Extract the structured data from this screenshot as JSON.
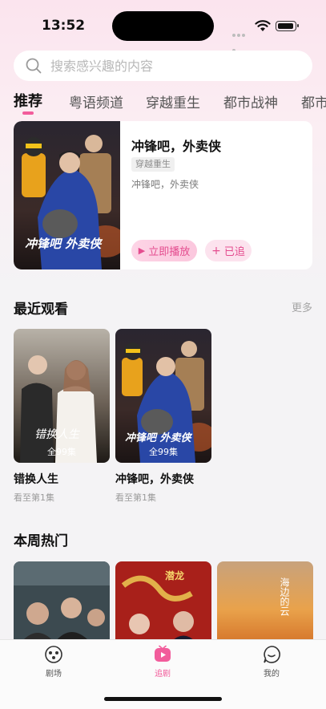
{
  "status_bar": {
    "time": "13:52"
  },
  "search": {
    "placeholder": "搜索感兴趣的内容",
    "value": ""
  },
  "category_tabs": [
    {
      "label": "推荐",
      "active": true
    },
    {
      "label": "粤语频道",
      "active": false
    },
    {
      "label": "穿越重生",
      "active": false
    },
    {
      "label": "都市战神",
      "active": false
    },
    {
      "label": "都市",
      "active": false
    }
  ],
  "featured": {
    "title": "冲锋吧，外卖侠",
    "genre": "穿越重生",
    "description": "冲锋吧，外卖侠",
    "play_label": "立即播放",
    "follow_label": "已追",
    "poster_text": "冲锋吧 外卖侠"
  },
  "recent": {
    "title": "最近观看",
    "more_label": "更多",
    "items": [
      {
        "title": "错换人生",
        "episodes": "全99集",
        "progress": "看至第1集",
        "poster_text": "错换人生"
      },
      {
        "title": "冲锋吧，外卖侠",
        "episodes": "全99集",
        "progress": "看至第1集",
        "poster_text": "冲锋吧 外卖侠"
      }
    ]
  },
  "weekly_hot": {
    "title": "本周热门",
    "poster_texts": [
      "",
      "潜龙",
      "海边的云"
    ]
  },
  "bottom_nav": [
    {
      "label": "剧场",
      "icon": "theater-icon",
      "active": false
    },
    {
      "label": "追剧",
      "icon": "play-tv-icon",
      "active": true
    },
    {
      "label": "我的",
      "icon": "profile-face-icon",
      "active": false
    }
  ],
  "colors": {
    "accent": "#f25c9b",
    "accent_light": "#fce3ee",
    "background": "#f4f3f5"
  }
}
